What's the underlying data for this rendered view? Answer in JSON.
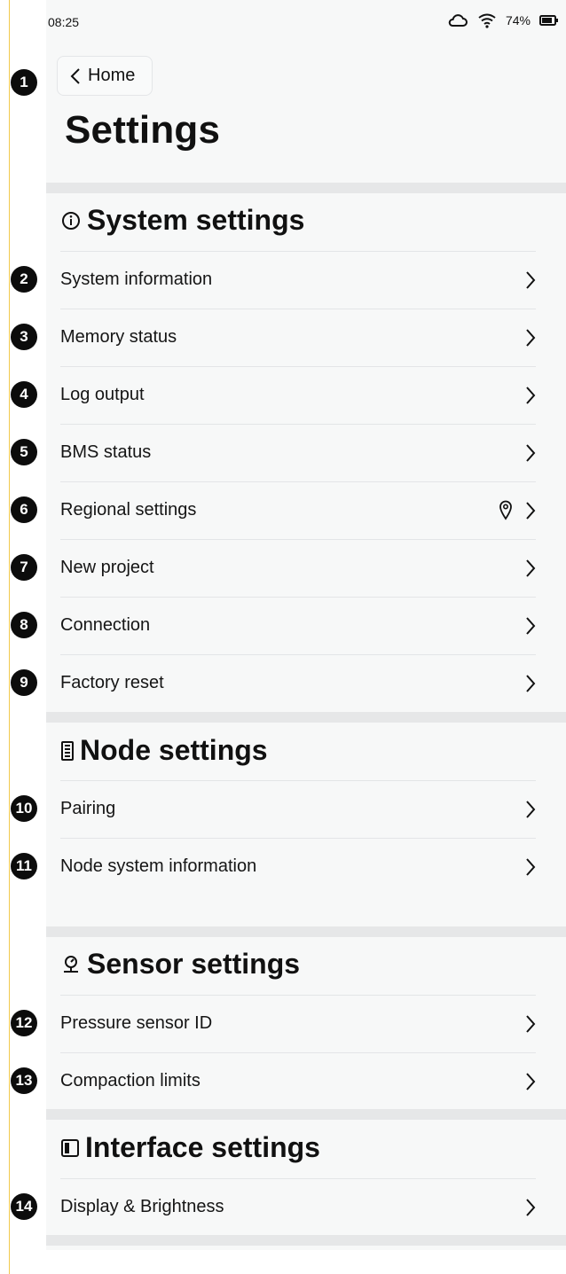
{
  "status_bar": {
    "time": "08:25",
    "battery": "74%"
  },
  "nav": {
    "back_label": "Home"
  },
  "page": {
    "title": "Settings"
  },
  "sections": {
    "system": {
      "title": "System settings",
      "items": [
        {
          "label": "System information"
        },
        {
          "label": "Memory status"
        },
        {
          "label": "Log output"
        },
        {
          "label": "BMS status"
        },
        {
          "label": "Regional settings"
        },
        {
          "label": "New project"
        },
        {
          "label": "Connection"
        },
        {
          "label": "Factory reset"
        }
      ]
    },
    "node": {
      "title": "Node settings",
      "items": [
        {
          "label": "Pairing"
        },
        {
          "label": "Node system information"
        }
      ]
    },
    "sensor": {
      "title": "Sensor settings",
      "items": [
        {
          "label": "Pressure sensor ID"
        },
        {
          "label": "Compaction limits"
        }
      ]
    },
    "interface": {
      "title": "Interface settings",
      "items": [
        {
          "label": "Display & Brightness"
        }
      ]
    }
  },
  "badges": [
    "1",
    "2",
    "3",
    "4",
    "5",
    "6",
    "7",
    "8",
    "9",
    "10",
    "11",
    "12",
    "13",
    "14"
  ],
  "icons": {
    "status": [
      "cloud-icon",
      "wifi-icon",
      "battery-icon"
    ],
    "sections": [
      "info-icon",
      "node-icon",
      "sensor-icon",
      "interface-icon"
    ],
    "row_trailing": [
      "chevron-right-icon",
      "location-pin-icon"
    ]
  }
}
